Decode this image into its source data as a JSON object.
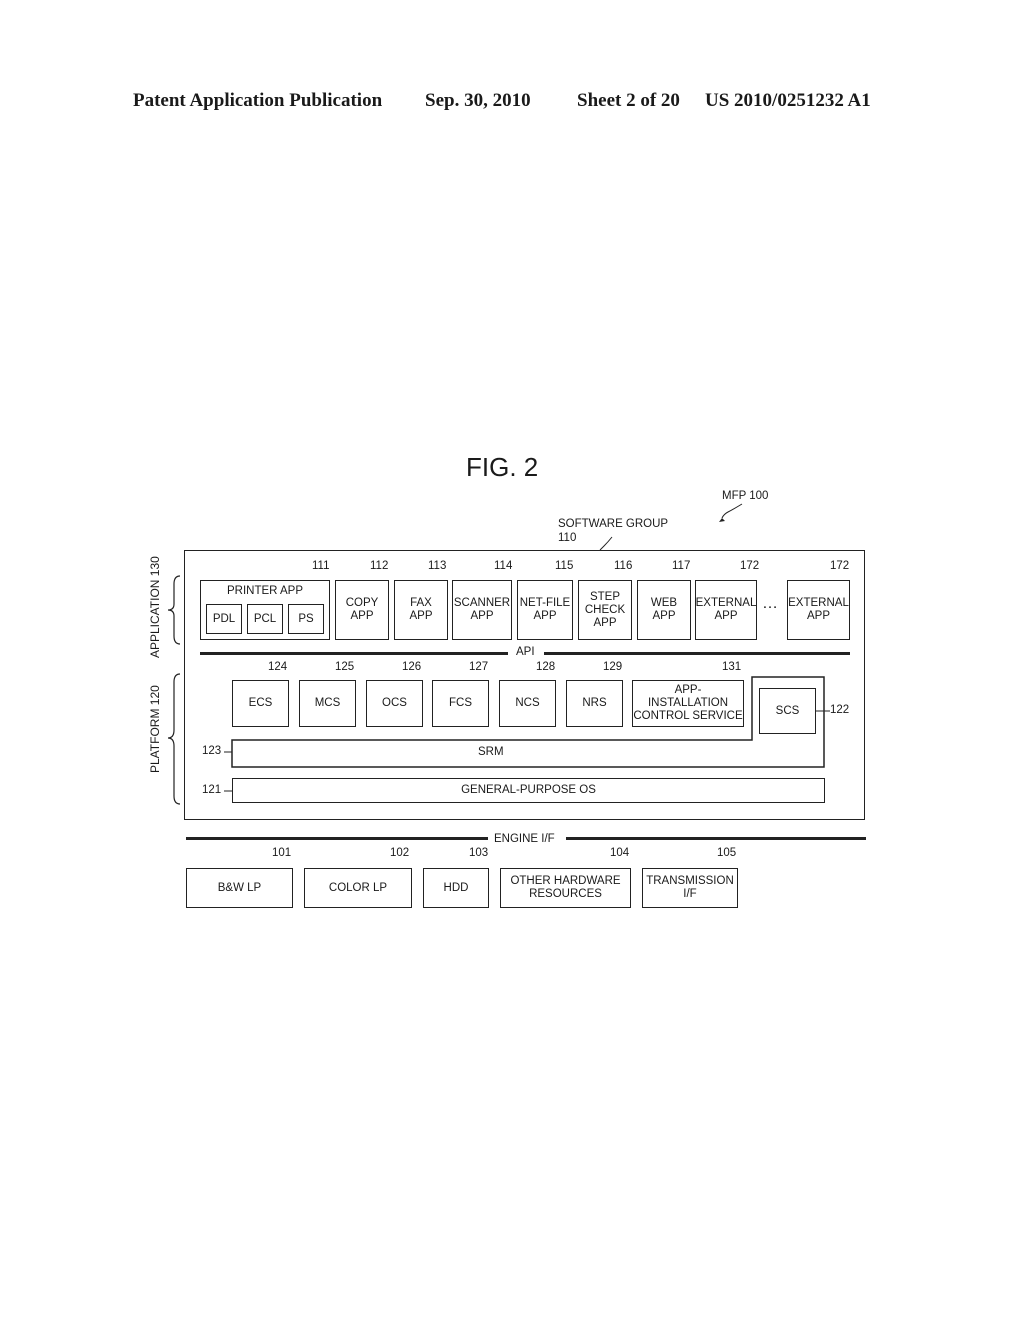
{
  "header": {
    "publication": "Patent Application Publication",
    "date": "Sep. 30, 2010",
    "sheet": "Sheet 2 of 20",
    "pub_number": "US 2010/0251232 A1"
  },
  "figure": {
    "title": "FIG. 2",
    "mfp_label": "MFP 100",
    "software_group_label": "SOFTWARE GROUP",
    "software_group_ref": "110",
    "application_label": "APPLICATION 130",
    "platform_label": "PLATFORM 120",
    "api_label": "API",
    "engine_if_label": "ENGINE I/F",
    "ellipsis": "…",
    "apps": [
      {
        "ref": "111",
        "label": "PRINTER APP",
        "sub": [
          "PDL",
          "PCL",
          "PS"
        ]
      },
      {
        "ref": "112",
        "label": "COPY\nAPP"
      },
      {
        "ref": "113",
        "label": "FAX\nAPP"
      },
      {
        "ref": "114",
        "label": "SCANNER\nAPP"
      },
      {
        "ref": "115",
        "label": "NET-FILE\nAPP"
      },
      {
        "ref": "116",
        "label": "STEP\nCHECK\nAPP"
      },
      {
        "ref": "117",
        "label": "WEB\nAPP"
      },
      {
        "ref": "172",
        "label": "EXTERNAL\nAPP"
      },
      {
        "ref": "172",
        "label": "EXTERNAL\nAPP"
      }
    ],
    "services": [
      {
        "ref": "124",
        "label": "ECS"
      },
      {
        "ref": "125",
        "label": "MCS"
      },
      {
        "ref": "126",
        "label": "OCS"
      },
      {
        "ref": "127",
        "label": "FCS"
      },
      {
        "ref": "128",
        "label": "NCS"
      },
      {
        "ref": "129",
        "label": "NRS"
      },
      {
        "ref": "131",
        "label": "APP-\nINSTALLATION\nCONTROL SERVICE"
      }
    ],
    "scs": {
      "ref": "122",
      "label": "SCS"
    },
    "srm": {
      "ref": "123",
      "label": "SRM"
    },
    "os": {
      "ref": "121",
      "label": "GENERAL-PURPOSE OS"
    },
    "hardware": [
      {
        "ref": "101",
        "label": "B&W LP"
      },
      {
        "ref": "102",
        "label": "COLOR LP"
      },
      {
        "ref": "103",
        "label": "HDD"
      },
      {
        "ref": "104",
        "label": "OTHER HARDWARE\nRESOURCES"
      },
      {
        "ref": "105",
        "label": "TRANSMISSION\nI/F"
      }
    ]
  }
}
